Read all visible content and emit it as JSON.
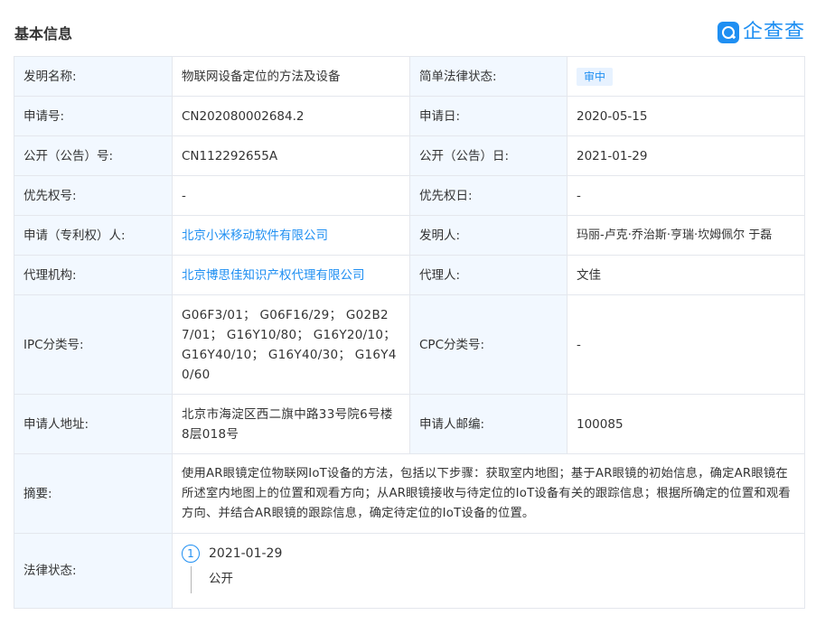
{
  "header": {
    "section_title": "基本信息",
    "brand_name": "企查查",
    "brand_color": "#1f8ff2"
  },
  "rows": {
    "invention_name": {
      "label": "发明名称:",
      "value": "物联网设备定位的方法及设备"
    },
    "legal_status_simple": {
      "label": "简单法律状态:",
      "value": "审中"
    },
    "application_no": {
      "label": "申请号:",
      "value": "CN202080002684.2"
    },
    "application_date": {
      "label": "申请日:",
      "value": "2020-05-15"
    },
    "publication_no": {
      "label": "公开（公告）号:",
      "value": "CN112292655A"
    },
    "publication_date": {
      "label": "公开（公告）日:",
      "value": "2021-01-29"
    },
    "priority_no": {
      "label": "优先权号:",
      "value": "-"
    },
    "priority_date": {
      "label": "优先权日:",
      "value": "-"
    },
    "applicant": {
      "label": "申请（专利权）人:",
      "value": "北京小米移动软件有限公司"
    },
    "inventor": {
      "label": "发明人:",
      "value": "玛丽-卢克·乔治斯·亨瑞·坎姆佩尔 于磊"
    },
    "agency": {
      "label": "代理机构:",
      "value": "北京博思佳知识产权代理有限公司"
    },
    "agent": {
      "label": "代理人:",
      "value": "文佳"
    },
    "ipc": {
      "label": "IPC分类号:",
      "value": "G06F3/01； G06F16/29； G02B27/01； G16Y10/80； G16Y20/10； G16Y40/10； G16Y40/30； G16Y40/60"
    },
    "cpc": {
      "label": "CPC分类号:",
      "value": "-"
    },
    "applicant_address": {
      "label": "申请人地址:",
      "value": "北京市海淀区西二旗中路33号院6号楼8层018号"
    },
    "applicant_postcode": {
      "label": "申请人邮编:",
      "value": "100085"
    },
    "abstract": {
      "label": "摘要:",
      "value": "使用AR眼镜定位物联网IoT设备的方法，包括以下步骤：获取室内地图；基于AR眼镜的初始信息，确定AR眼镜在所述室内地图上的位置和观看方向；从AR眼镜接收与待定位的IoT设备有关的跟踪信息；根据所确定的位置和观看方向、并结合AR眼镜的跟踪信息，确定待定位的IoT设备的位置。"
    },
    "legal_status": {
      "label": "法律状态:",
      "events": [
        {
          "index": "1",
          "date": "2021-01-29",
          "status": "公开"
        }
      ]
    }
  }
}
